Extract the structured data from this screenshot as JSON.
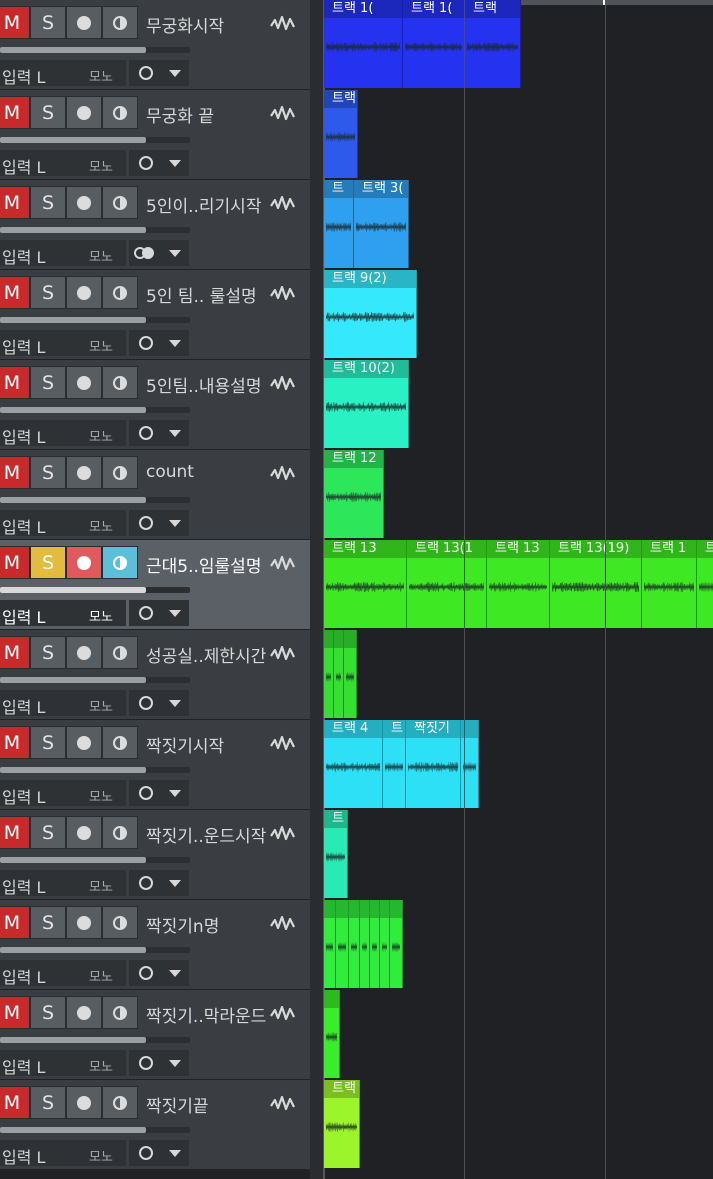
{
  "track_labels": {
    "mute": "M",
    "solo": "S",
    "input": "입력 L",
    "mono": "모노"
  },
  "colors": {
    "mute_red": "#c8292b",
    "solo_yellow": "#e3bb3f",
    "record_red": "#e05a5d",
    "monitor_blue": "#5bbfd9",
    "header_bg": "#3a3e42",
    "header_selected_bg": "#5b6067",
    "lane_bg": "#1f2124"
  },
  "tracks": [
    {
      "name": "무궁화시작",
      "color": "#2532f0",
      "clips": [
        "트랙 1(",
        "트랙 1(",
        "트랙"
      ]
    },
    {
      "name": "무궁화 끝",
      "color": "#2d5aeb",
      "clips": [
        "트랙"
      ]
    },
    {
      "name": "5인이..리기시작",
      "color": "#2fa0ef",
      "clips": [
        "트",
        "트랙 3("
      ],
      "monitor_dual": true
    },
    {
      "name": "5인 팀.. 룰설명",
      "color": "#36e8fb",
      "clips": [
        "트랙 9(2)"
      ]
    },
    {
      "name": "5인팀..내용설명",
      "color": "#29f1c4",
      "clips": [
        "트랙 10(2)"
      ]
    },
    {
      "name": "count",
      "color": "#2ee65a",
      "clips": [
        "트랙 12"
      ]
    },
    {
      "name": "근대5..임룰설명",
      "color": "#3ee923",
      "clips": [
        "트랙 13",
        "트랙 13(1",
        "트랙 13",
        "트랙 13(19)",
        "트랙 1",
        "트"
      ],
      "selected": true
    },
    {
      "name": "성공실..제한시간",
      "color": "#34df30",
      "clips": [
        "",
        "",
        ""
      ]
    },
    {
      "name": "짝짓기시작",
      "color": "#2ee0f6",
      "clips": [
        "트랙 4",
        "트",
        "짝짓기",
        ""
      ]
    },
    {
      "name": "짝짓기..운드시작",
      "color": "#29e9b4",
      "clips": [
        "트"
      ]
    },
    {
      "name": "짝짓기n명",
      "color": "#30ec3c",
      "clips": [
        "",
        "",
        "",
        "",
        "",
        "",
        ""
      ]
    },
    {
      "name": "짝짓기..막라운드",
      "color": "#3aed2a",
      "clips": [
        ""
      ]
    },
    {
      "name": "짝짓기끝",
      "color": "#9bf52a",
      "clips": [
        "트랙"
      ]
    }
  ]
}
